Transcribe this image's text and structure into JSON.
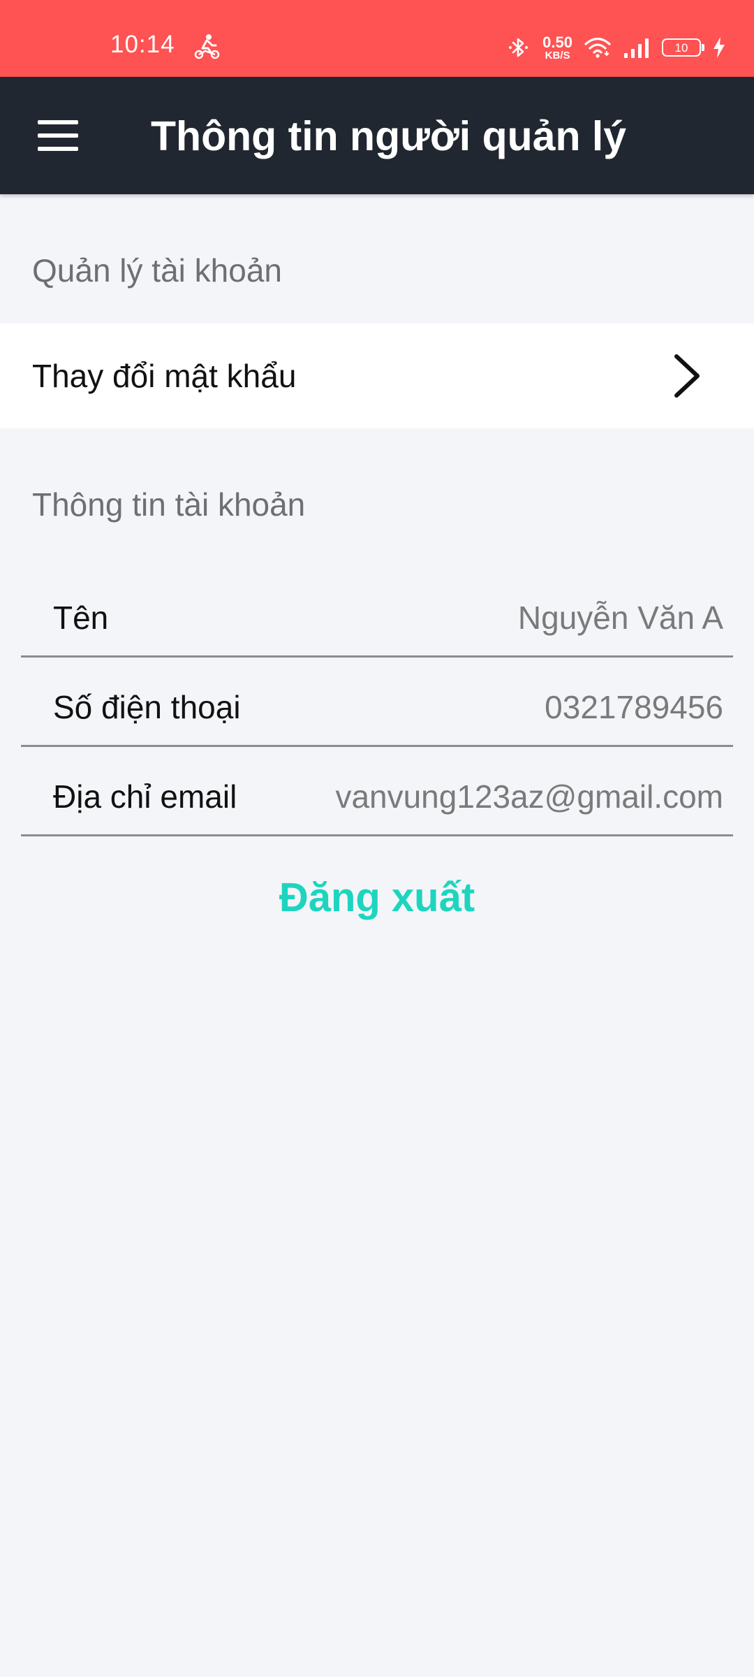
{
  "status_bar": {
    "time": "10:14",
    "net_speed": "0.50",
    "net_speed_unit": "KB/S",
    "battery_level": "10",
    "icons": [
      "rider-icon",
      "bluetooth-icon",
      "wifi-icon",
      "signal-icon",
      "battery-icon",
      "charging-icon"
    ],
    "background_color": "#FF5252"
  },
  "app_bar": {
    "title": "Thông tin người quản lý",
    "menu_icon": "hamburger-menu-icon",
    "background_color": "#212730"
  },
  "account_management": {
    "section_title": "Quản lý tài khoản",
    "change_password_label": "Thay đổi mật khẩu",
    "chevron_icon": "chevron-right-icon"
  },
  "account_info": {
    "section_title": "Thông tin tài khoản",
    "rows": [
      {
        "label": "Tên",
        "value": "Nguyễn Văn A"
      },
      {
        "label": "Số điện thoại",
        "value": "0321789456"
      },
      {
        "label": "Địa chỉ email",
        "value": "vanvung123az@gmail.com"
      }
    ]
  },
  "logout": {
    "label": "Đăng xuất",
    "color": "#1DD5BF"
  }
}
